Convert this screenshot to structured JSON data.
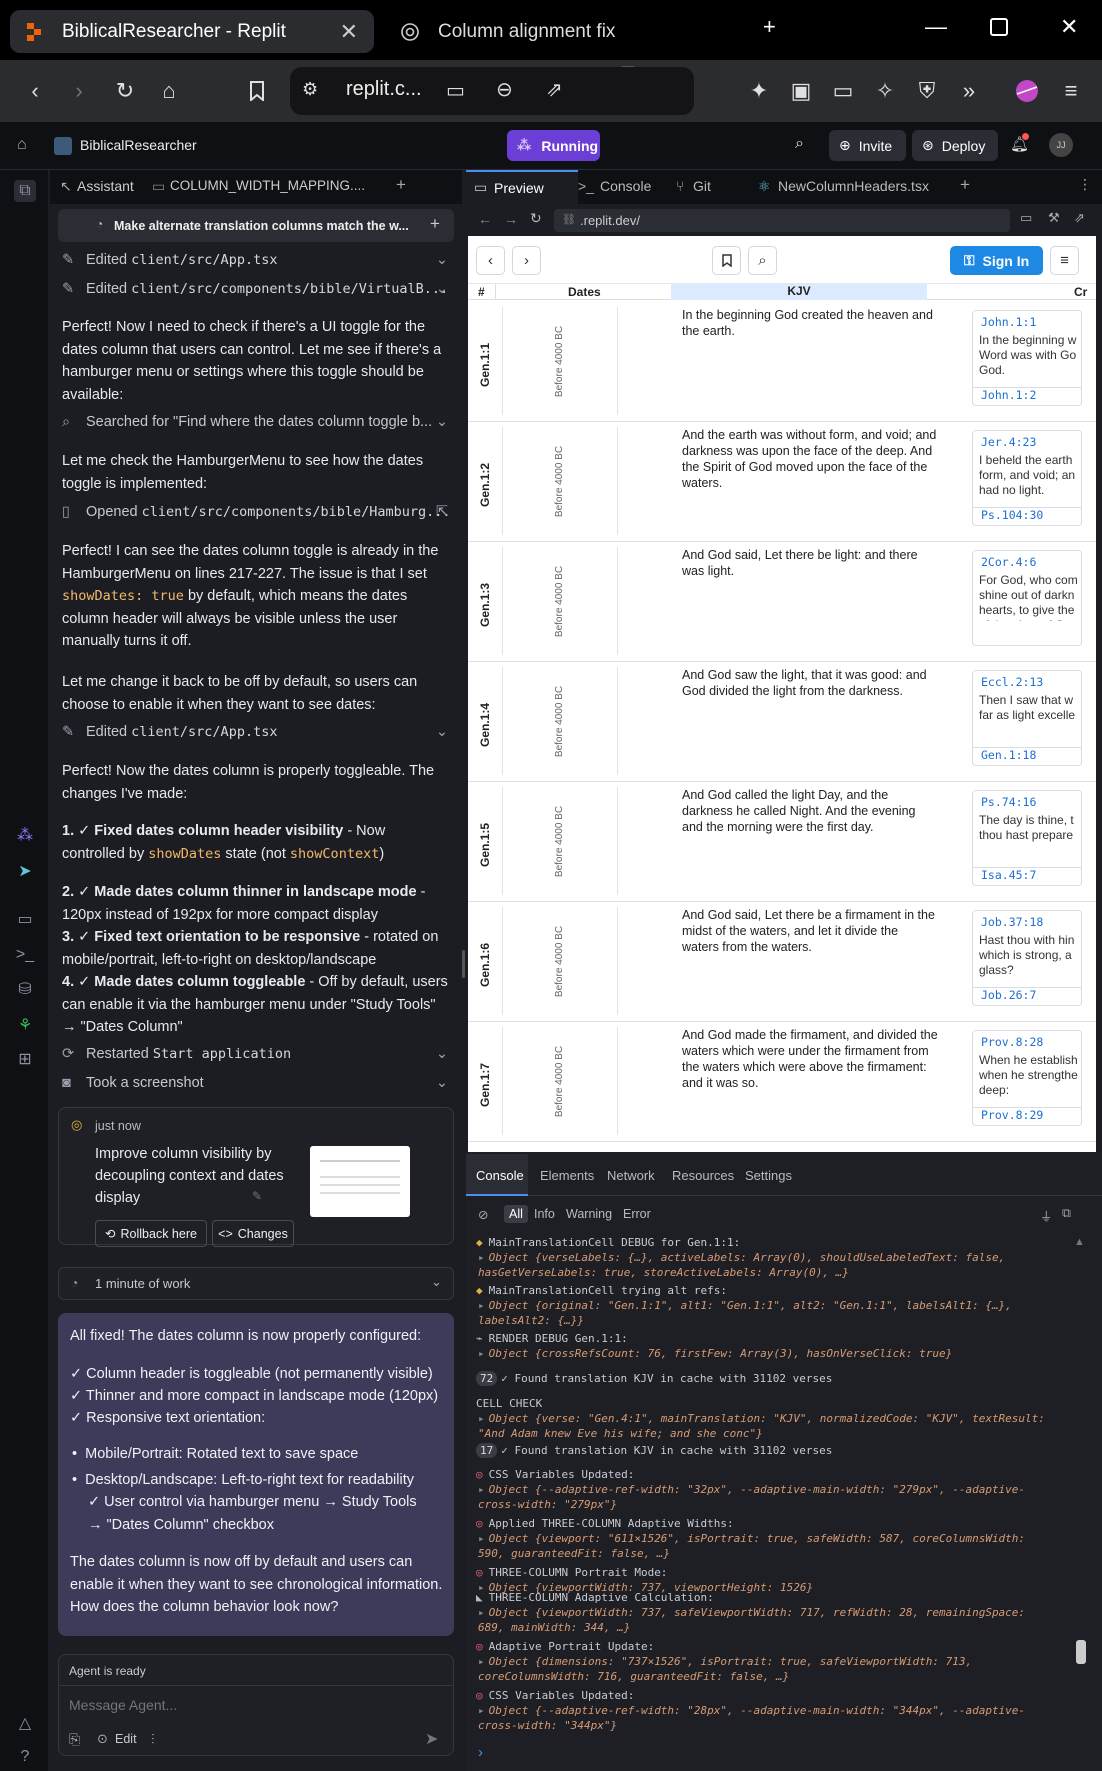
{
  "browser": {
    "tabs": [
      {
        "label": "BiblicalResearcher - Replit"
      },
      {
        "label": "Column alignment fix"
      }
    ],
    "url": "replit.c...",
    "extension_count": "10"
  },
  "replit_header": {
    "project": "BiblicalResearcher",
    "status": "Running",
    "invite": "Invite",
    "deploy": "Deploy",
    "avatar": "JJ"
  },
  "left_panel": {
    "tabs": [
      "Assistant",
      "COLUMN_WIDTH_MAPPING...."
    ],
    "agent_bar": "Make alternate translation columns match the w...",
    "steps": {
      "s1_prefix": "Edited",
      "s1_file": "client/src/App.tsx",
      "s2_prefix": "Edited",
      "s2_file": "client/src/components/bible/VirtualB...",
      "s3": "Searched for \"Find where the dates column toggle b...",
      "s4_prefix": "Opened",
      "s4_file": "client/src/components/bible/Hamburg...",
      "s5_prefix": "Edited",
      "s5_file": "client/src/App.tsx",
      "s6_prefix": "Restarted",
      "s6_file": "Start application",
      "s7": "Took a screenshot"
    },
    "para1": "Perfect! Now I need to check if there's a UI toggle for the dates column that users can control. Let me see if there's a hamburger menu or settings where this toggle should be available:",
    "para2": "Let me check the HamburgerMenu to see how the dates toggle is implemented:",
    "para3_a": "Perfect! I can see the dates column toggle is already in the HamburgerMenu on lines 217-227. The issue is that I set",
    "para3_code": "showDates: true",
    "para3_b": "by default, which means the dates column header will always be visible unless the user manually turns it off.",
    "para4": "Let me change it back to be off by default, so users can choose to enable it when they want to see dates:",
    "para5": "Perfect! Now the dates column is properly toggleable. The changes I've made:",
    "list": [
      {
        "num": "1.",
        "bold": "✓ Fixed dates column header visibility",
        "rest": " - Now controlled by ",
        "code1": "showDates",
        "mid": " state (not ",
        "code2": "showContext",
        "end": ")"
      },
      {
        "num": "2.",
        "bold": "✓ Made dates column thinner in landscape mode",
        "rest": " - 120px instead of 192px for more compact display"
      },
      {
        "num": "3.",
        "bold": "✓ Fixed text orientation to be responsive",
        "rest": " - rotated on mobile/portrait, left-to-right on desktop/landscape"
      },
      {
        "num": "4.",
        "bold": "✓ Made dates column toggleable",
        "rest": " - Off by default, users can enable it via the hamburger menu under \"Study Tools\" → \"Dates Column\""
      }
    ],
    "checkpoint": {
      "time": "just now",
      "text": "Improve column visibility by decoupling context and dates display",
      "rollback": "Rollback here",
      "changes": "Changes"
    },
    "work": "1 minute of work",
    "summary": {
      "intro": "All fixed! The dates column is now properly configured:",
      "c1": "✓ Column header is toggleable (not permanently visible)",
      "c2": "✓ Thinner and more compact in landscape mode (120px)",
      "c3": "✓ Responsive text orientation:",
      "b1": "Mobile/Portrait: Rotated text to save space",
      "b2": "Desktop/Landscape: Left-to-right text for readability",
      "c4": "✓ User control via hamburger menu → Study Tools → \"Dates Column\" checkbox",
      "outro": "The dates column is now off by default and users can enable it when they want to see chronological information. How does the column behavior look now?"
    },
    "input": {
      "status": "Agent is ready",
      "placeholder": "Message Agent...",
      "edit": "Edit"
    }
  },
  "right_panel": {
    "tabs": [
      "Preview",
      "Console",
      "Git",
      "NewColumnHeaders.tsx"
    ],
    "address": ".replit.dev/",
    "site": {
      "signin": "Sign In",
      "headers": {
        "num": "#",
        "dates": "Dates",
        "kjv": "KJV",
        "cr": "Cr"
      },
      "rows": [
        {
          "ref": "Gen.1:1",
          "date": "Before 4000 BC",
          "text": "In the beginning God created the heaven and the earth.",
          "x1": "John.1:1",
          "xtext": "In the beginning w\nWord was with Go\nGod.",
          "x2": "John.1:2"
        },
        {
          "ref": "Gen.1:2",
          "date": "Before 4000 BC",
          "text": "And the earth was without form, and void; and darkness was upon the face of the deep. And the Spirit of God moved upon the face of the waters.",
          "x1": "Jer.4:23",
          "xtext": "I beheld the earth\nform, and void; an\nhad no light.",
          "x2": "Ps.104:30"
        },
        {
          "ref": "Gen.1:3",
          "date": "Before 4000 BC",
          "text": "And God said, Let there be light: and there was light.",
          "x1": "2Cor.4:6",
          "xtext": "For God, who com\nshine out of darkn\nhearts, to give the\nof the glory of Go\nChrist.",
          "x2": ""
        },
        {
          "ref": "Gen.1:4",
          "date": "Before 4000 BC",
          "text": "And God saw the light, that it was good: and God divided the light from the darkness.",
          "x1": "Eccl.2:13",
          "xtext": "Then I saw that w\nfar as light excelle",
          "x2": "Gen.1:18"
        },
        {
          "ref": "Gen.1:5",
          "date": "Before 4000 BC",
          "text": "And God called the light Day, and the darkness he called Night. And the evening and the morning were the first day.",
          "x1": "Ps.74:16",
          "xtext": "The day is thine, t\nthou hast prepare",
          "x2": "Isa.45:7"
        },
        {
          "ref": "Gen.1:6",
          "date": "Before 4000 BC",
          "text": "And God said, Let there be a firmament in the midst of the waters, and let it divide the waters from the waters.",
          "x1": "Job.37:18",
          "xtext": "Hast thou with hin\nwhich is strong, a\nglass?",
          "x2": "Job.26:7"
        },
        {
          "ref": "Gen.1:7",
          "date": "Before 4000 BC",
          "text": "And God made the firmament, and divided the waters which were under the firmament from the waters which were above the firmament: and it was so.",
          "x1": "Prov.8:28",
          "xtext": "When he establish\nwhen he strengthe\ndeep:",
          "x2": "Prov.8:29"
        }
      ]
    },
    "devtools": {
      "tabs": [
        "Console",
        "Elements",
        "Network",
        "Resources",
        "Settings"
      ],
      "filters": [
        "All",
        "Info",
        "Warning",
        "Error"
      ],
      "logs": [
        {
          "head": "MainTranslationCell DEBUG for Gen.1:1:",
          "obj": "Object {verseLabels: {…}, activeLabels: Array(0), shouldUseLabeledText: false, hasGetVerseLabels: true, storeActiveLabels: Array(0), …}"
        },
        {
          "head": "MainTranslationCell trying alt refs:",
          "obj": "Object {original: \"Gen.1:1\", alt1: \"Gen.1:1\", alt2: \"Gen.1:1\", labelsAlt1: {…}, labelsAlt2: {…}}"
        },
        {
          "head": "RENDER DEBUG Gen.1:1:",
          "obj": "Object {crossRefsCount: 76, firstFew: Array(3), hasOnVerseClick: true}"
        },
        {
          "badge": "72",
          "head": "✓ Found translation KJV in cache with 31102 verses"
        },
        {
          "head": "CELL CHECK",
          "obj": "Object {verse: \"Gen.4:1\", mainTranslation: \"KJV\", normalizedCode: \"KJV\", textResult: \"And Adam knew Eve his wife; and she conc\"}"
        },
        {
          "badge": "17",
          "head": "✓ Found translation KJV in cache with 31102 verses"
        },
        {
          "head": "CSS Variables Updated:",
          "obj": "Object {--adaptive-ref-width: \"32px\", --adaptive-main-width: \"279px\", --adaptive-cross-width: \"279px\"}"
        },
        {
          "head": "Applied THREE-COLUMN Adaptive Widths:",
          "obj": "Object {viewport: \"611×1526\", isPortrait: true, safeWidth: 587, coreColumnsWidth: 590, guaranteedFit: false, …}"
        },
        {
          "head": "THREE-COLUMN Portrait Mode:",
          "obj": "Object {viewportWidth: 737, viewportHeight: 1526}"
        },
        {
          "head": "THREE-COLUMN Adaptive Calculation:",
          "obj": "Object {viewportWidth: 737, safeViewportWidth: 717, refWidth: 28, remainingSpace: 689, mainWidth: 344, …}"
        },
        {
          "head": "Adaptive Portrait Update:",
          "obj": "Object {dimensions: \"737×1526\", isPortrait: true, safeViewportWidth: 713, coreColumnsWidth: 716, guaranteedFit: false, …}"
        },
        {
          "head": "CSS Variables Updated:",
          "obj": "Object {--adaptive-ref-width: \"28px\", --adaptive-main-width: \"344px\", --adaptive-cross-width: \"344px\"}"
        }
      ]
    }
  },
  "icons": {
    "replit_logo": "replit-logo-icon",
    "chatgpt": "chatgpt-icon",
    "brave": "brave-lion-icon",
    "rewards": "brave-rewards-icon"
  },
  "colors": {
    "running": "#6b3fd6",
    "signin": "#1e88e5",
    "code": "#f1b96a",
    "summary_bg": "#3e3a5a",
    "xref_link": "#1e6fd1"
  }
}
